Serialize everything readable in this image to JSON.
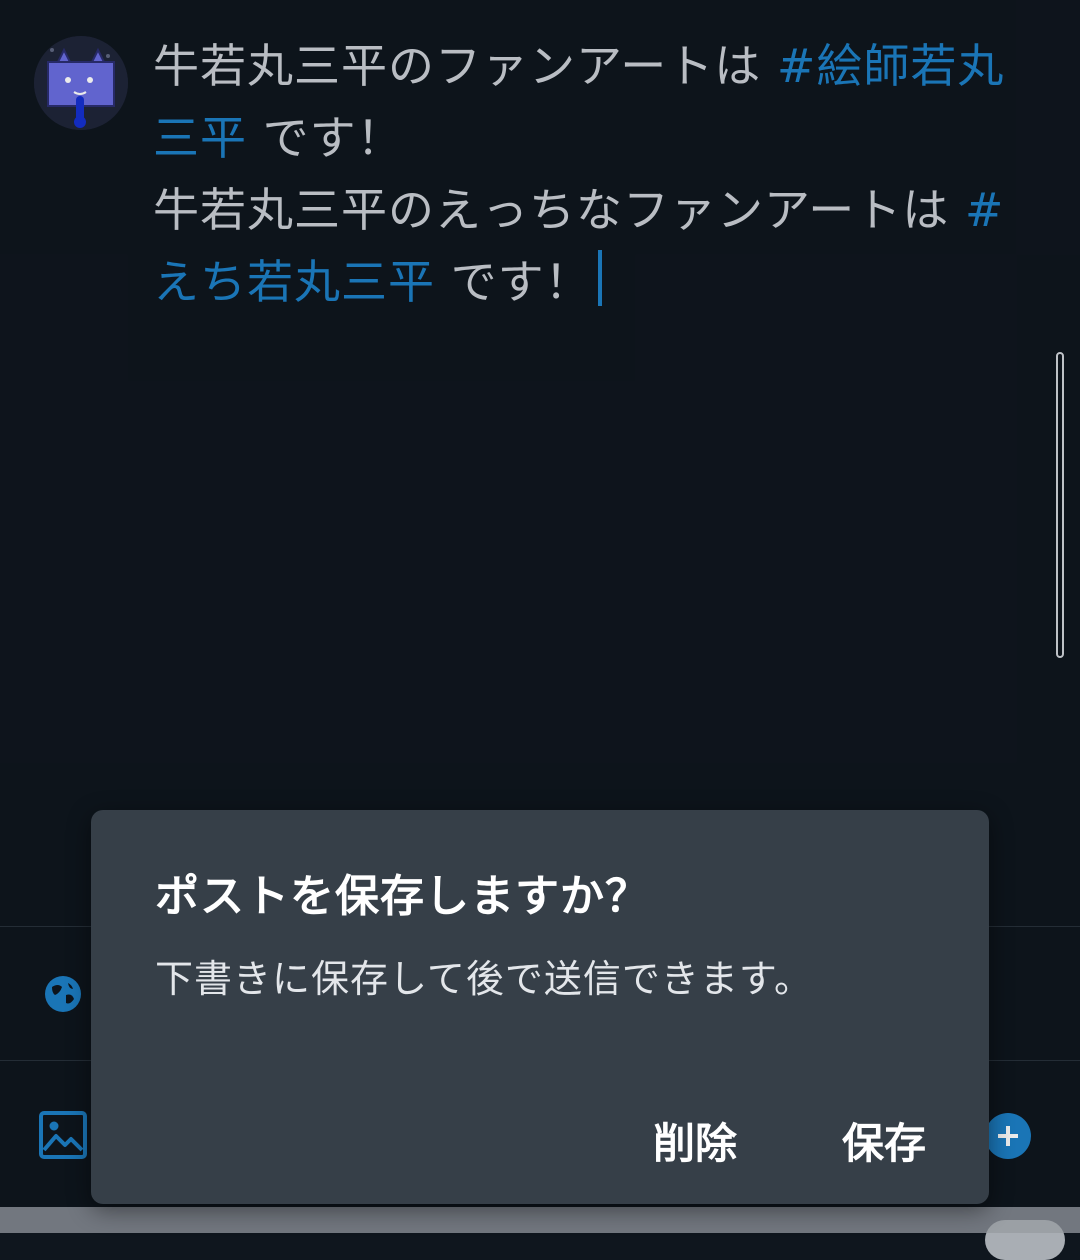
{
  "composer": {
    "line1_text": "牛若丸三平のファンアートは ",
    "line1_hashtag": "#絵師若丸",
    "line2_hashtag": "三平",
    "line2_text": " です！",
    "line3_text": "牛若丸三平のえっちなファンアートは ",
    "line3_hashtag": "#",
    "line4_hashtag": "えち若丸三平",
    "line4_text": " です！"
  },
  "dialog": {
    "title": "ポストを保存しますか？",
    "message": "下書きに保存して後で送信できます。",
    "delete_label": "削除",
    "save_label": "保存"
  },
  "icons": {
    "globe": "globe-icon",
    "image": "image-icon",
    "add": "add-icon"
  },
  "colors": {
    "background": "#0f161e",
    "hashtag": "#1d7fc6",
    "dialog_bg": "#363f48"
  }
}
